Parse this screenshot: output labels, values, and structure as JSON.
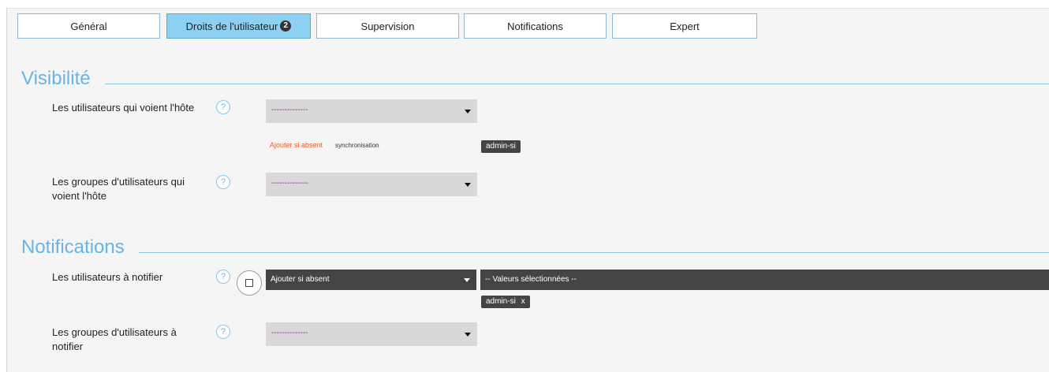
{
  "tabs": [
    {
      "label": "Général"
    },
    {
      "label": "Droits de l'utilisateur",
      "badge": "2"
    },
    {
      "label": "Supervision"
    },
    {
      "label": "Notifications"
    },
    {
      "label": "Expert"
    }
  ],
  "visibility": {
    "title": "Visibilité",
    "users_label": "Les utilisateurs qui voient l'hôte",
    "users_select_placeholder": "--------------",
    "users_add_mode": "Ajouter si absent",
    "users_sync": "synchronisation",
    "users_tag": "admin-si",
    "groups_label": "Les groupes d'utilisateurs qui voient l'hôte",
    "groups_select_placeholder": "--------------"
  },
  "notifications": {
    "title": "Notifications",
    "users_label": "Les utilisateurs à notifier",
    "users_mode_select": "Ajouter si absent",
    "users_values_select": "-- Valeurs sélectionnées --",
    "users_tag": "admin-si",
    "users_tag_remove": "x",
    "groups_label": "Les groupes d'utilisateurs à notifier",
    "groups_select_placeholder": "--------------"
  },
  "help_symbol": "?",
  "colors": {
    "accent": "#6ab4e2",
    "active_tab": "#8dd0f1",
    "placeholder": "#a0219c",
    "add_mode_text": "#f05a28",
    "tag_bg": "#444444"
  }
}
